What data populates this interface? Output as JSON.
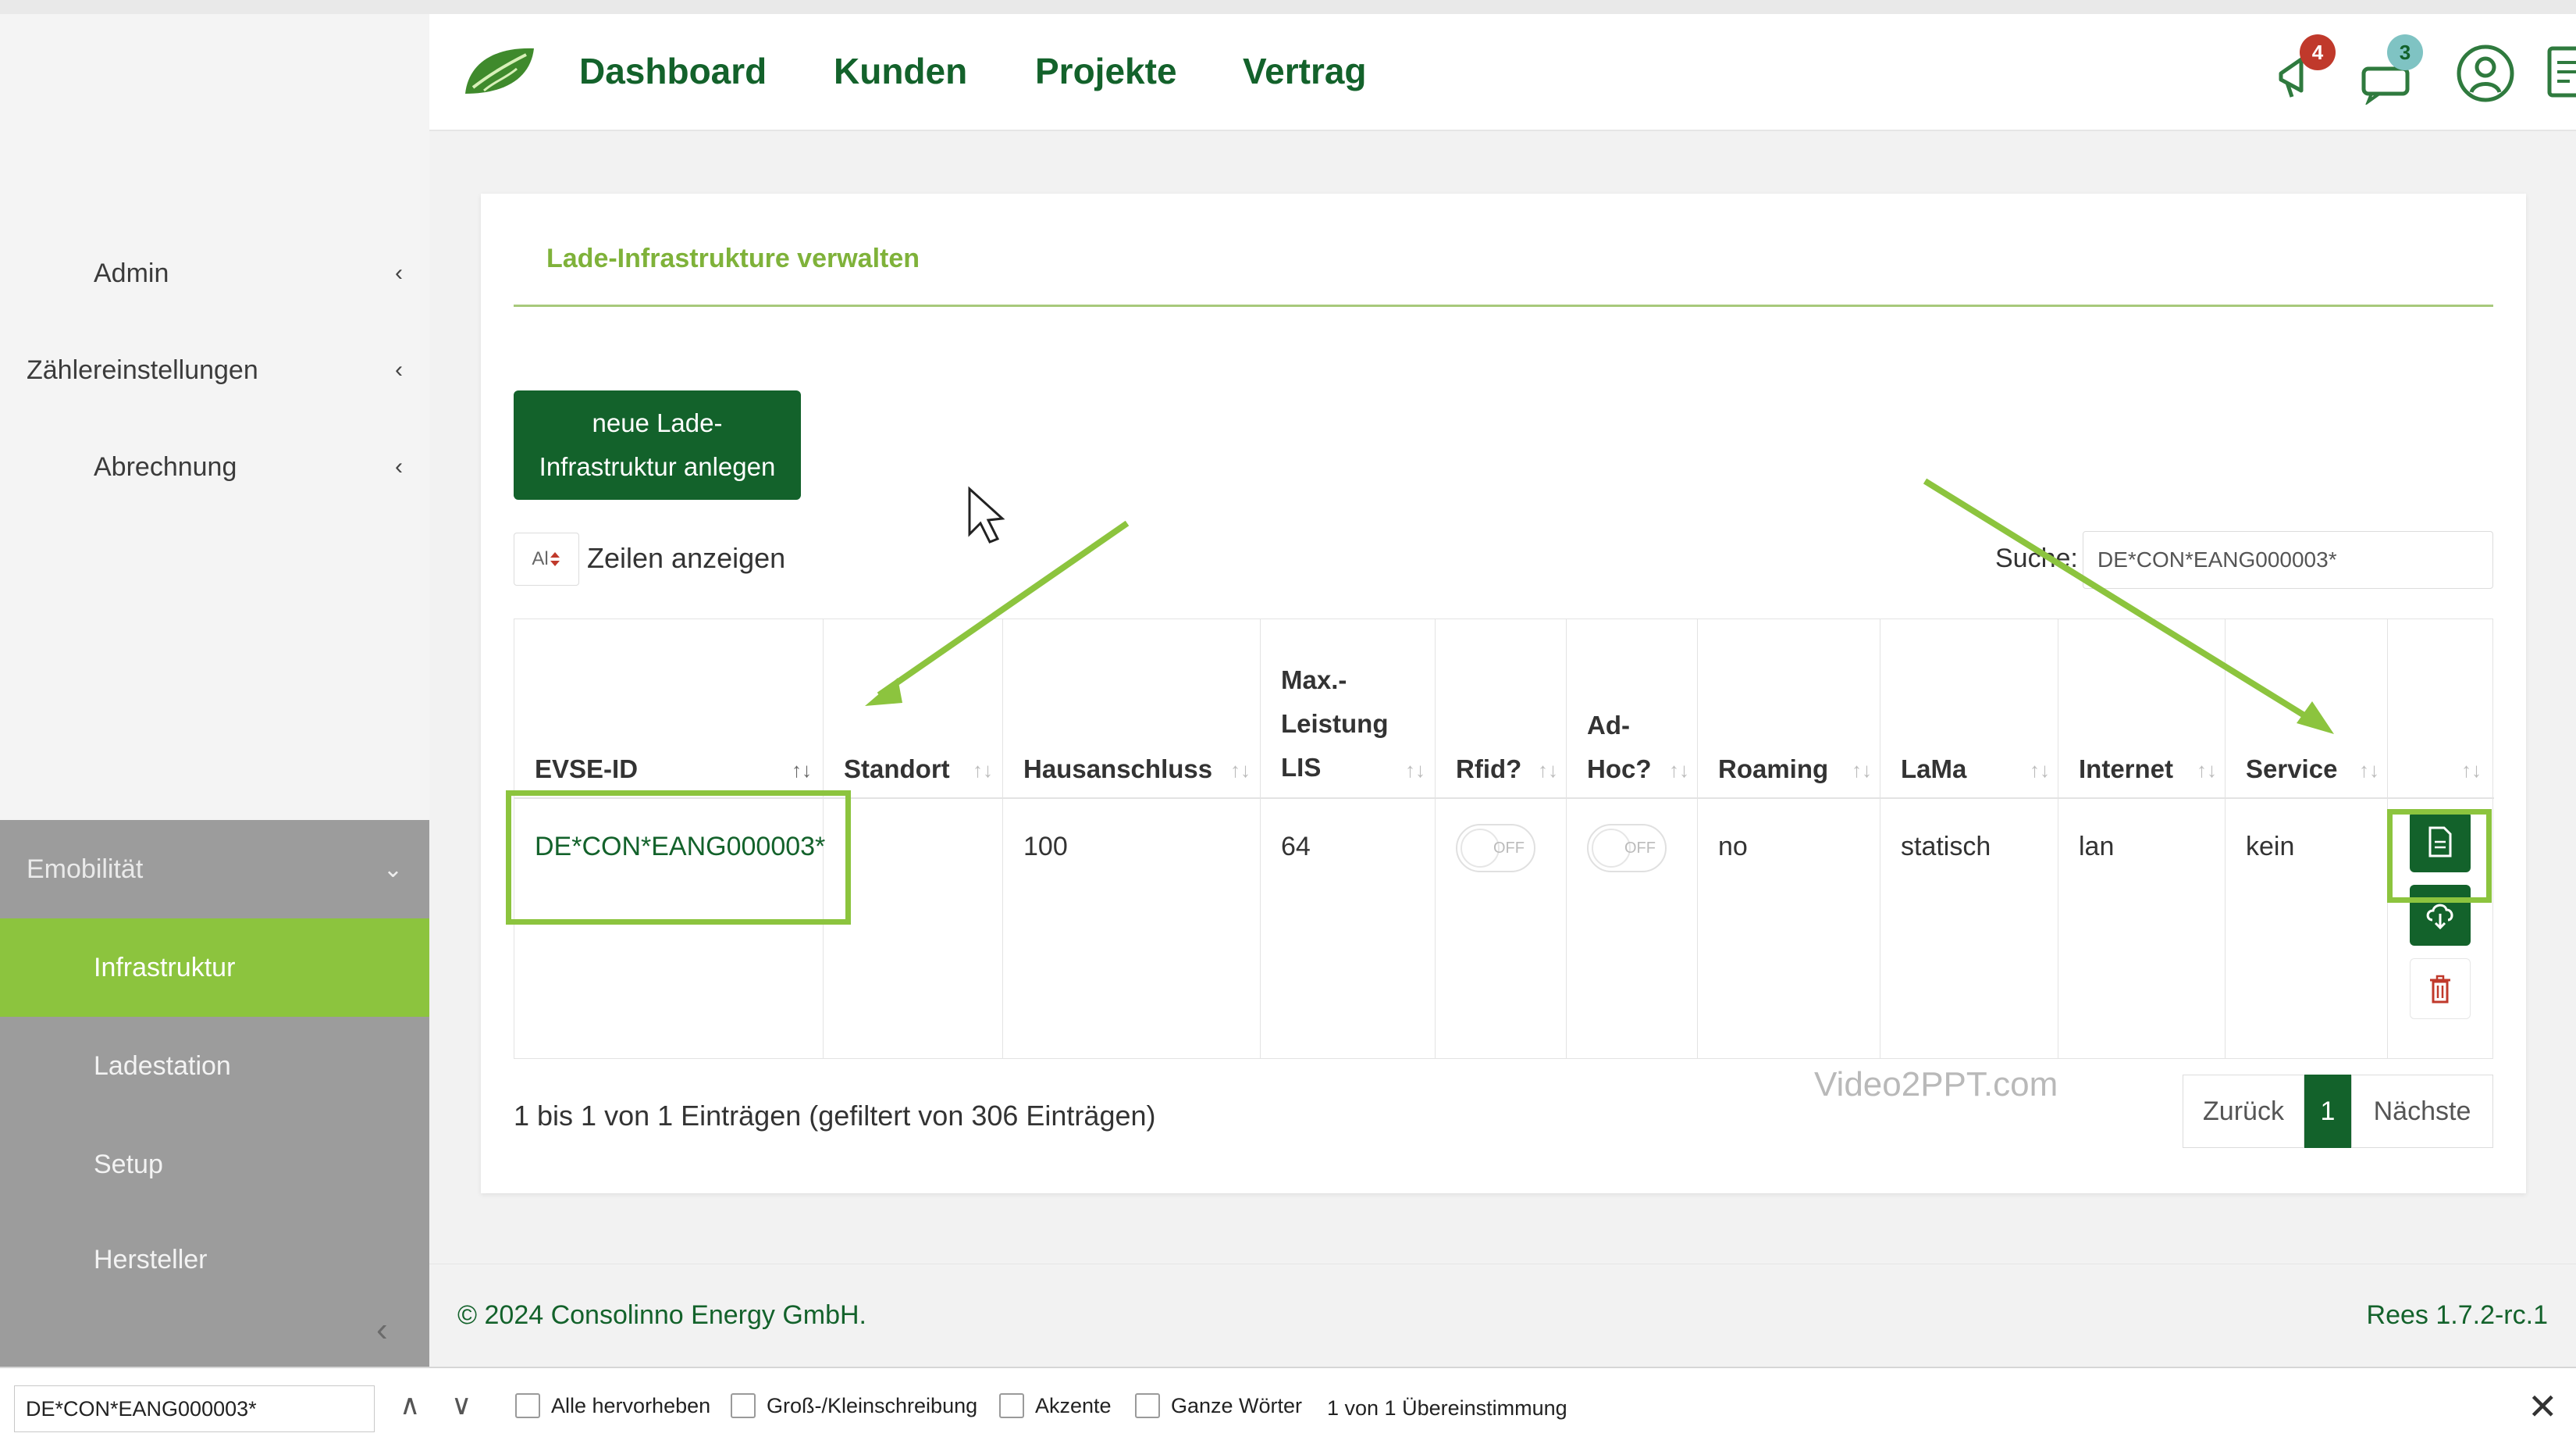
{
  "topbar": {
    "nav": [
      "Dashboard",
      "Kunden",
      "Projekte",
      "Vertrag"
    ],
    "notifications_count": "4",
    "messages_count": "3"
  },
  "sidebar": {
    "items": [
      {
        "label": "Admin",
        "chevron": "‹"
      },
      {
        "label": "Zählereinstellungen",
        "chevron": "‹"
      },
      {
        "label": "Abrechnung",
        "chevron": "‹"
      },
      {
        "label": "Emobilität",
        "chevron": "⌄"
      },
      {
        "label": "Infrastruktur"
      },
      {
        "label": "Ladestation"
      },
      {
        "label": "Setup"
      },
      {
        "label": "Hersteller"
      }
    ],
    "collapse_symbol": "‹"
  },
  "card": {
    "title": "Lade-Infrastrukture verwalten",
    "new_button_line1": "neue Lade-",
    "new_button_line2": "Infrastruktur anlegen",
    "length_select_value": "Al",
    "length_label": "Zeilen anzeigen",
    "search_label": "Suche:",
    "search_value": "DE*CON*EANG000003*"
  },
  "table": {
    "headers": {
      "evse": "EVSE-ID",
      "standort": "Standort",
      "hausanschluss": "Hausanschluss",
      "maxleistung_1": "Max.-",
      "maxleistung_2": "Leistung",
      "maxleistung_3": "LIS",
      "rfid": "Rfid?",
      "adhoc_1": "Ad-",
      "adhoc_2": "Hoc?",
      "roaming": "Roaming",
      "lama": "LaMa",
      "internet": "Internet",
      "service": "Service"
    },
    "row": {
      "evse": "DE*CON*EANG000003*",
      "standort": "",
      "hausanschluss": "100",
      "maxleistung": "64",
      "rfid_state": "OFF",
      "adhoc_state": "OFF",
      "roaming": "no",
      "lama": "statisch",
      "internet": "lan",
      "service": "kein"
    },
    "sort_symbol": "↑↓"
  },
  "info": "1 bis 1 von 1 Einträgen (gefiltert von 306 Einträgen)",
  "watermark": "Video2PPT.com",
  "pagination": {
    "prev": "Zurück",
    "current": "1",
    "next": "Nächste"
  },
  "footer": {
    "copyright": "© 2024 Consolinno Energy GmbH.",
    "version": "Rees 1.7.2-rc.1"
  },
  "findbar": {
    "value": "DE*CON*EANG000003*",
    "up": "∧",
    "down": "∨",
    "options": [
      "Alle hervorheben",
      "Groß-/Kleinschreibung",
      "Akzente",
      "Ganze Wörter"
    ],
    "count": "1 von 1 Übereinstimmung",
    "close": "✕"
  },
  "colors": {
    "brand_dark": "#13622b",
    "brand_light": "#8cc43e",
    "danger": "#c0392b"
  }
}
